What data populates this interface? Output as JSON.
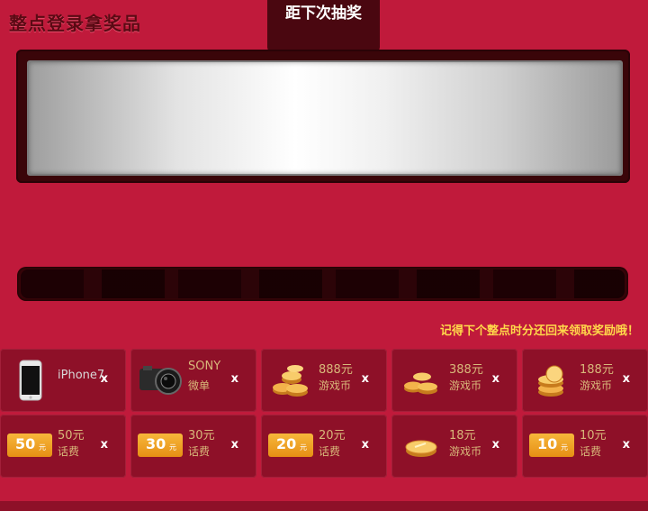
{
  "header": {
    "title": "整点登录拿奖品",
    "tab_label": "距下次抽奖"
  },
  "reminder": "记得下个整点时分还回来领取奖励哦！",
  "prizes": [
    {
      "name_line1": "iPhone7",
      "name_line2": "",
      "icon": "phone-icon",
      "mult": "x"
    },
    {
      "name_line1": "SONY",
      "name_line2": "微单",
      "icon": "camera-icon",
      "mult": "x"
    },
    {
      "name_line1": "888元",
      "name_line2": "游戏币",
      "icon": "coins-icon",
      "mult": "x"
    },
    {
      "name_line1": "388元",
      "name_line2": "游戏币",
      "icon": "coins-icon",
      "mult": "x"
    },
    {
      "name_line1": "188元",
      "name_line2": "游戏币",
      "icon": "coins-icon",
      "mult": "x"
    },
    {
      "name_line1": "50元",
      "name_line2": "话费",
      "icon": "ticket-icon",
      "ticket_num": "50",
      "ticket_unit": "元",
      "mult": "x"
    },
    {
      "name_line1": "30元",
      "name_line2": "话费",
      "icon": "ticket-icon",
      "ticket_num": "30",
      "ticket_unit": "元",
      "mult": "x"
    },
    {
      "name_line1": "20元",
      "name_line2": "话费",
      "icon": "ticket-icon",
      "ticket_num": "20",
      "ticket_unit": "元",
      "mult": "x"
    },
    {
      "name_line1": "18元",
      "name_line2": "游戏币",
      "icon": "coin-icon",
      "mult": "x"
    },
    {
      "name_line1": "10元",
      "name_line2": "话费",
      "icon": "ticket-icon",
      "ticket_num": "10",
      "ticket_unit": "元",
      "mult": "x"
    }
  ],
  "colors": {
    "background": "#c01a3b",
    "dark_frame": "#3a0509",
    "cell": "#8e1028",
    "reminder_text": "#ffd84a",
    "prize_text": "#d8b87a"
  }
}
